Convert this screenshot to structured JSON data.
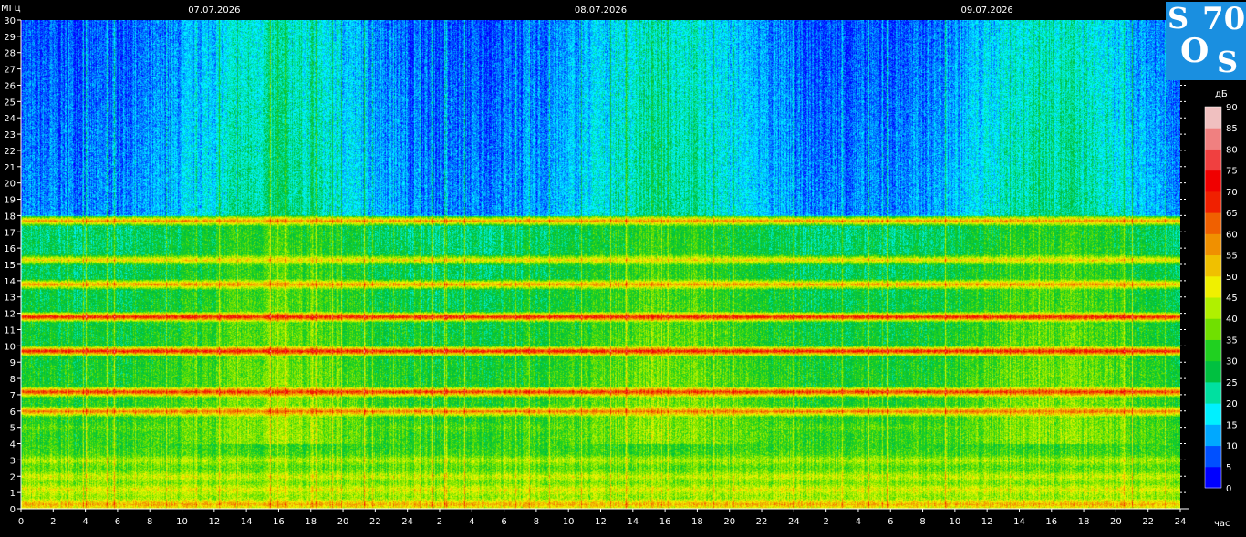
{
  "chart_data": {
    "type": "heatmap",
    "title": "",
    "xlabel": "час",
    "ylabel": "МГц",
    "y_ticks": [
      0,
      1,
      2,
      3,
      4,
      5,
      6,
      7,
      8,
      9,
      10,
      11,
      12,
      13,
      14,
      15,
      16,
      17,
      18,
      19,
      20,
      21,
      22,
      23,
      24,
      25,
      26,
      27,
      28,
      29,
      30
    ],
    "ylim": [
      0,
      30
    ],
    "x_tick_labels": [
      "0",
      "2",
      "4",
      "6",
      "8",
      "10",
      "12",
      "14",
      "16",
      "18",
      "20",
      "22",
      "24",
      "2",
      "4",
      "6",
      "8",
      "10",
      "12",
      "14",
      "16",
      "18",
      "20",
      "22",
      "24",
      "2",
      "4",
      "6",
      "8",
      "10",
      "12",
      "14",
      "16",
      "18",
      "20",
      "22",
      "24"
    ],
    "date_labels": [
      "07.07.2026",
      "08.07.2026",
      "09.07.2026"
    ],
    "colorbar": {
      "label": "дБ",
      "levels": [
        0,
        5,
        10,
        15,
        20,
        25,
        30,
        35,
        40,
        45,
        50,
        55,
        60,
        65,
        70,
        75,
        80,
        85,
        90
      ],
      "colors": [
        "#0000ff",
        "#0050ff",
        "#00a8ff",
        "#00f0ff",
        "#00e0a0",
        "#00c040",
        "#20d020",
        "#70e000",
        "#b0f000",
        "#f0f000",
        "#f0c000",
        "#f09000",
        "#f06000",
        "#f02000",
        "#f00000",
        "#f04040",
        "#f08080",
        "#f0c0c0",
        "#ffffff"
      ]
    },
    "bands": [
      {
        "mhz": 0.3,
        "level": 52
      },
      {
        "mhz": 1.2,
        "level": 44
      },
      {
        "mhz": 2.0,
        "level": 42
      },
      {
        "mhz": 3.0,
        "level": 40
      },
      {
        "mhz": 4.1,
        "level": 30
      },
      {
        "mhz": 5.0,
        "level": 33
      },
      {
        "mhz": 6.0,
        "level": 58
      },
      {
        "mhz": 7.2,
        "level": 65
      },
      {
        "mhz": 9.7,
        "level": 68
      },
      {
        "mhz": 11.8,
        "level": 68
      },
      {
        "mhz": 13.8,
        "level": 55
      },
      {
        "mhz": 15.3,
        "level": 48
      },
      {
        "mhz": 17.7,
        "level": 55
      }
    ]
  },
  "logo": {
    "c1": "S",
    "c2": "70",
    "c3": "O",
    "c4": "S"
  }
}
